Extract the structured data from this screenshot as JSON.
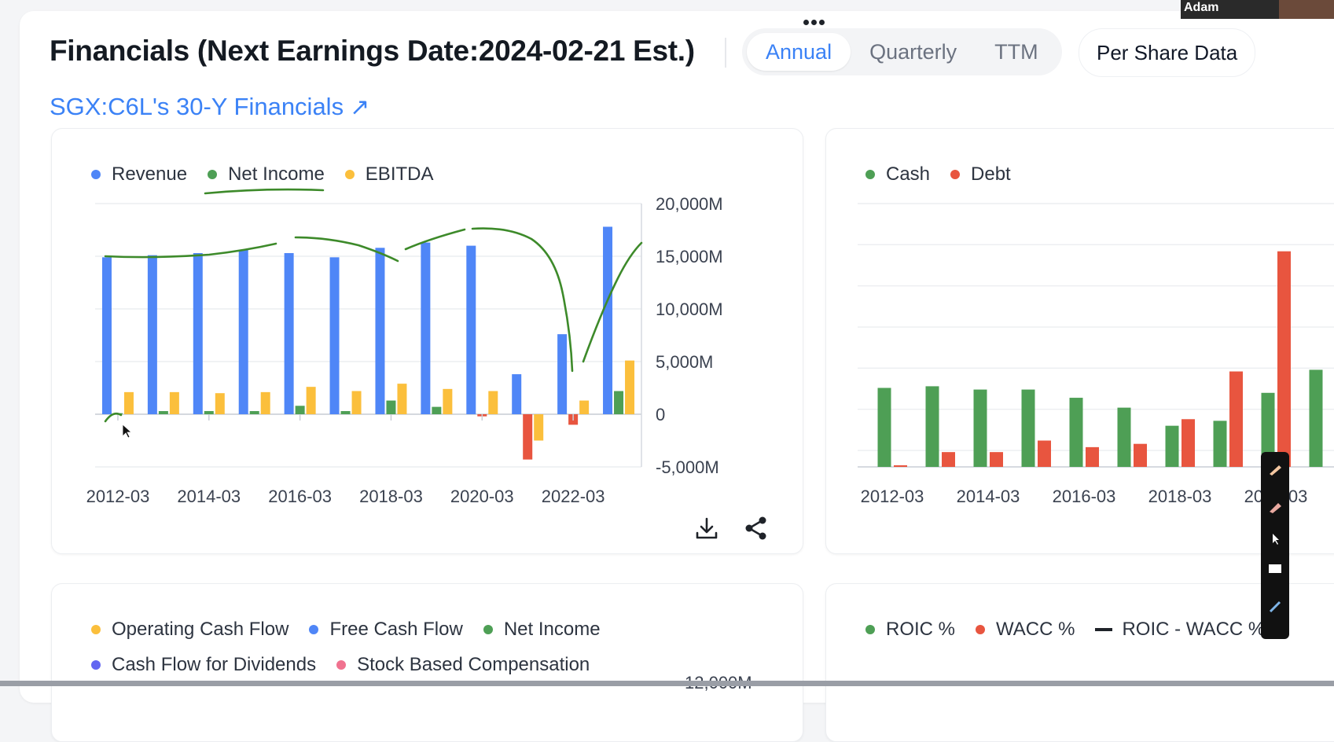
{
  "header": {
    "title": "Financials (Next Earnings Date:2024-02-21 Est.)",
    "period_tabs": [
      {
        "label": "Annual",
        "active": true
      },
      {
        "label": "Quarterly",
        "active": false
      },
      {
        "label": "TTM",
        "active": false
      }
    ],
    "per_share_label": "Per Share Data",
    "financials_link": "SGX:C6L's 30-Y Financials",
    "link_icon": "arrow-up-right-icon"
  },
  "colors": {
    "accent": "#3b82f6",
    "revenue": "#4f86f7",
    "net_income": "#4e9f55",
    "ebitda": "#fbbf3c",
    "negative": "#e8553f",
    "cash": "#4e9f55",
    "debt": "#e8553f",
    "annotation": "#3d8a2a"
  },
  "video": {
    "participant": "Adam"
  },
  "cards": {
    "income": {
      "legend": [
        {
          "label": "Revenue",
          "color": "#4f86f7"
        },
        {
          "label": "Net Income",
          "color": "#4e9f55"
        },
        {
          "label": "EBITDA",
          "color": "#fbbf3c"
        }
      ],
      "actions": [
        "download-icon",
        "share-icon"
      ]
    },
    "balance": {
      "legend": [
        {
          "label": "Cash",
          "color": "#4e9f55"
        },
        {
          "label": "Debt",
          "color": "#e8553f"
        }
      ]
    },
    "cashflow": {
      "legend_row1": [
        {
          "label": "Operating Cash Flow",
          "color": "#fbbf3c"
        },
        {
          "label": "Free Cash Flow",
          "color": "#4f86f7"
        },
        {
          "label": "Net Income",
          "color": "#4e9f55"
        }
      ],
      "legend_row2": [
        {
          "label": "Cash Flow for Dividends",
          "color": "#6366f1"
        },
        {
          "label": "Stock Based Compensation",
          "color": "#f0728f"
        }
      ],
      "axis_top_label": "12,000M"
    },
    "roic": {
      "legend": [
        {
          "label": "ROIC %",
          "color": "#4e9f55",
          "swatch": "dot"
        },
        {
          "label": "WACC %",
          "color": "#e8553f",
          "swatch": "dot"
        },
        {
          "label": "ROIC - WACC %",
          "color": "#1f2329",
          "swatch": "line"
        }
      ]
    }
  },
  "chart_data": [
    {
      "type": "bar",
      "categories": [
        "2012-03",
        "2013-03",
        "2014-03",
        "2015-03",
        "2016-03",
        "2017-03",
        "2018-03",
        "2019-03",
        "2020-03",
        "2021-03",
        "2022-03",
        "2023-03"
      ],
      "x_tick_labels": [
        "2012-03",
        "2014-03",
        "2016-03",
        "2018-03",
        "2020-03",
        "2022-03"
      ],
      "series": [
        {
          "name": "Revenue",
          "values": [
            14900,
            15100,
            15300,
            15600,
            15300,
            14900,
            15800,
            16300,
            16000,
            3800,
            7600,
            17800
          ]
        },
        {
          "name": "Net Income",
          "values": [
            100,
            300,
            300,
            300,
            800,
            300,
            1300,
            700,
            -200,
            -4300,
            -1000,
            2200
          ]
        },
        {
          "name": "EBITDA",
          "values": [
            2100,
            2100,
            2000,
            2100,
            2600,
            2200,
            2900,
            2400,
            2200,
            -2500,
            1300,
            5100
          ]
        }
      ],
      "y_tick_labels": [
        "20,000M",
        "15,000M",
        "10,000M",
        "5,000M",
        "0",
        "-5,000M"
      ],
      "ylim": [
        -5000,
        20000
      ],
      "xlabel": "",
      "ylabel": "",
      "legend": "top-left",
      "grid": true
    },
    {
      "type": "bar",
      "categories": [
        "2012-03",
        "2013-03",
        "2014-03",
        "2015-03",
        "2016-03",
        "2017-03",
        "2018-03",
        "2019-03",
        "2020-03",
        "2021-03"
      ],
      "x_tick_labels": [
        "2012-03",
        "2014-03",
        "2016-03",
        "2018-03",
        "2020-03"
      ],
      "series": [
        {
          "name": "Cash",
          "values": [
            4800,
            4900,
            4700,
            4700,
            4200,
            3600,
            2500,
            2800,
            4500,
            5900
          ]
        },
        {
          "name": "Debt",
          "values": [
            100,
            900,
            900,
            1600,
            1200,
            1400,
            2900,
            5800,
            13100,
            0
          ]
        }
      ],
      "ylim": [
        0,
        16000
      ],
      "xlabel": "",
      "ylabel": "",
      "legend": "top-left",
      "grid": true
    }
  ]
}
